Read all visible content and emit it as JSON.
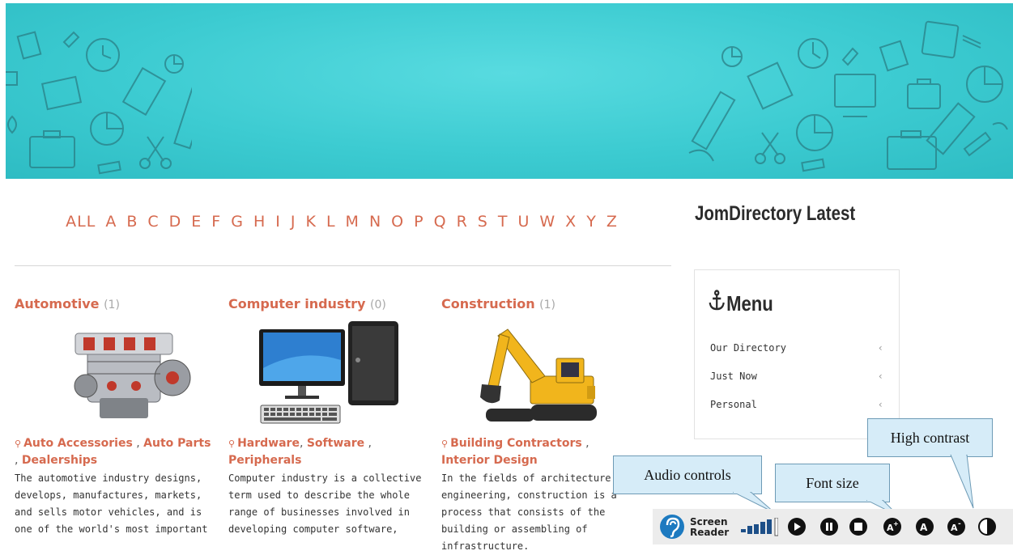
{
  "alphabet": [
    "ALL",
    "A",
    "B",
    "C",
    "D",
    "E",
    "F",
    "G",
    "H",
    "I",
    "J",
    "K",
    "L",
    "M",
    "N",
    "O",
    "P",
    "Q",
    "R",
    "S",
    "T",
    "U",
    "W",
    "X",
    "Y",
    "Z"
  ],
  "categories": [
    {
      "title": "Automotive",
      "count": "(1)",
      "image_icon": "engine-image",
      "subs": [
        "Auto Accessories",
        "Auto Parts",
        "Dealerships"
      ],
      "description": "The automotive industry designs, develops, manufactures, markets, and sells motor vehicles, and is one of the world's most important"
    },
    {
      "title": "Computer industry",
      "count": "(0)",
      "image_icon": "computer-image",
      "subs": [
        "Hardware",
        "Software",
        "Peripherals"
      ],
      "description": "Computer industry is a collective term used to describe the whole range of businesses involved in developing computer software,"
    },
    {
      "title": "Construction",
      "count": "(1)",
      "image_icon": "excavator-image",
      "subs": [
        "Building Contractors",
        "Interior Design"
      ],
      "description": "In the fields of architecture and engineering, construction is a process that consists of the building or assembling of infrastructure."
    }
  ],
  "sidebar": {
    "title": "JomDirectory Latest",
    "menu": {
      "heading": "Menu",
      "icon": "anchor-icon",
      "items": [
        "Our Directory",
        "Just Now",
        "Personal"
      ]
    }
  },
  "callouts": {
    "audio": "Audio controls",
    "font": "Font size",
    "contrast": "High contrast"
  },
  "toolbar": {
    "screen_reader_line1": "Screen",
    "screen_reader_line2": "Reader"
  },
  "colors": {
    "banner": "#3ccbd1",
    "link": "#d66a4f",
    "count": "#a8a8a8",
    "callout_bg": "#d6ecf8",
    "toolbar_bg": "#ececec"
  }
}
